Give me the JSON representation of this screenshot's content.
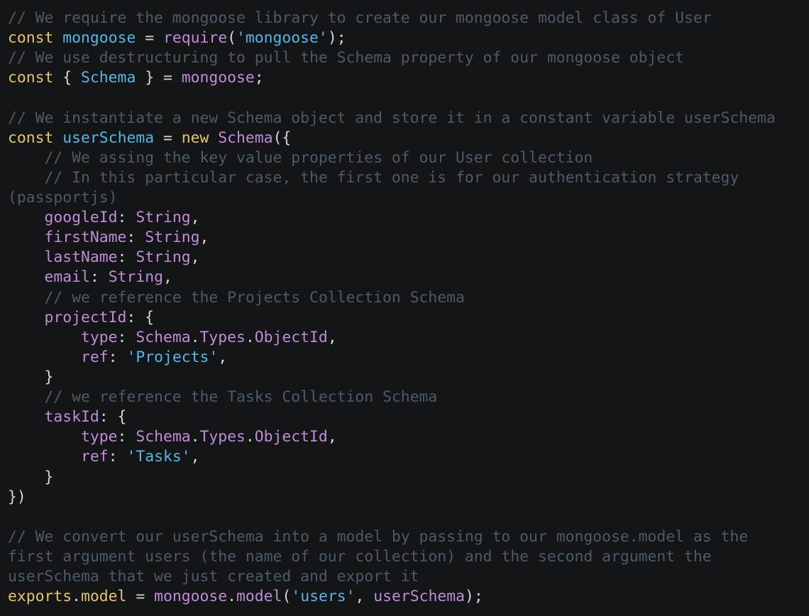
{
  "colors": {
    "background": "#141517",
    "keyword": "#e8c46a",
    "identifier": "#56b6e8",
    "function": "#c08bd8",
    "string": "#56b6e8",
    "comment": "#4e5a66",
    "punctuation": "#d6d6d6",
    "property": "#c08bd8"
  },
  "code_lines": [
    [
      {
        "t": "// We require the mongoose library to create our mongoose model class of User",
        "k": "comment"
      }
    ],
    [
      {
        "t": "const",
        "k": "keyword"
      },
      {
        "t": " ",
        "k": "punctuation"
      },
      {
        "t": "mongoose",
        "k": "identifier"
      },
      {
        "t": " = ",
        "k": "punctuation"
      },
      {
        "t": "require",
        "k": "function"
      },
      {
        "t": "(",
        "k": "punctuation"
      },
      {
        "t": "'mongoose'",
        "k": "string"
      },
      {
        "t": ");",
        "k": "punctuation"
      }
    ],
    [
      {
        "t": "// We use destructuring to pull the Schema property of our mongoose object",
        "k": "comment"
      }
    ],
    [
      {
        "t": "const",
        "k": "keyword"
      },
      {
        "t": " { ",
        "k": "punctuation"
      },
      {
        "t": "Schema",
        "k": "identifier"
      },
      {
        "t": " } = ",
        "k": "punctuation"
      },
      {
        "t": "mongoose",
        "k": "function"
      },
      {
        "t": ";",
        "k": "punctuation"
      }
    ],
    [],
    [
      {
        "t": "// We instantiate a new Schema object and store it in a constant variable userSchema",
        "k": "comment"
      }
    ],
    [
      {
        "t": "const",
        "k": "keyword"
      },
      {
        "t": " ",
        "k": "punctuation"
      },
      {
        "t": "userSchema",
        "k": "identifier"
      },
      {
        "t": " = ",
        "k": "punctuation"
      },
      {
        "t": "new",
        "k": "keyword"
      },
      {
        "t": " ",
        "k": "punctuation"
      },
      {
        "t": "Schema",
        "k": "function"
      },
      {
        "t": "({",
        "k": "punctuation"
      }
    ],
    [
      {
        "t": "    // We assing the key value properties of our User collection",
        "k": "comment"
      }
    ],
    [
      {
        "t": "    // In this particular case, the first one is for our authentication strategy",
        "k": "comment"
      }
    ],
    [
      {
        "t": "(passportjs)",
        "k": "comment"
      }
    ],
    [
      {
        "t": "    ",
        "k": "punctuation"
      },
      {
        "t": "googleId",
        "k": "property"
      },
      {
        "t": ": ",
        "k": "punctuation"
      },
      {
        "t": "String",
        "k": "function"
      },
      {
        "t": ",",
        "k": "punctuation"
      }
    ],
    [
      {
        "t": "    ",
        "k": "punctuation"
      },
      {
        "t": "firstName",
        "k": "property"
      },
      {
        "t": ": ",
        "k": "punctuation"
      },
      {
        "t": "String",
        "k": "function"
      },
      {
        "t": ",",
        "k": "punctuation"
      }
    ],
    [
      {
        "t": "    ",
        "k": "punctuation"
      },
      {
        "t": "lastName",
        "k": "property"
      },
      {
        "t": ": ",
        "k": "punctuation"
      },
      {
        "t": "String",
        "k": "function"
      },
      {
        "t": ",",
        "k": "punctuation"
      }
    ],
    [
      {
        "t": "    ",
        "k": "punctuation"
      },
      {
        "t": "email",
        "k": "property"
      },
      {
        "t": ": ",
        "k": "punctuation"
      },
      {
        "t": "String",
        "k": "function"
      },
      {
        "t": ",",
        "k": "punctuation"
      }
    ],
    [
      {
        "t": "    // we reference the Projects Collection Schema",
        "k": "comment"
      }
    ],
    [
      {
        "t": "    ",
        "k": "punctuation"
      },
      {
        "t": "projectId",
        "k": "property"
      },
      {
        "t": ": {",
        "k": "punctuation"
      }
    ],
    [
      {
        "t": "        ",
        "k": "punctuation"
      },
      {
        "t": "type",
        "k": "property"
      },
      {
        "t": ": ",
        "k": "punctuation"
      },
      {
        "t": "Schema",
        "k": "function"
      },
      {
        "t": ".",
        "k": "punctuation"
      },
      {
        "t": "Types",
        "k": "function"
      },
      {
        "t": ".",
        "k": "punctuation"
      },
      {
        "t": "ObjectId",
        "k": "function"
      },
      {
        "t": ",",
        "k": "punctuation"
      }
    ],
    [
      {
        "t": "        ",
        "k": "punctuation"
      },
      {
        "t": "ref",
        "k": "property"
      },
      {
        "t": ": ",
        "k": "punctuation"
      },
      {
        "t": "'Projects'",
        "k": "string"
      },
      {
        "t": ",",
        "k": "punctuation"
      }
    ],
    [
      {
        "t": "    }",
        "k": "punctuation"
      }
    ],
    [
      {
        "t": "    // we reference the Tasks Collection Schema",
        "k": "comment"
      }
    ],
    [
      {
        "t": "    ",
        "k": "punctuation"
      },
      {
        "t": "taskId",
        "k": "property"
      },
      {
        "t": ": {",
        "k": "punctuation"
      }
    ],
    [
      {
        "t": "        ",
        "k": "punctuation"
      },
      {
        "t": "type",
        "k": "property"
      },
      {
        "t": ": ",
        "k": "punctuation"
      },
      {
        "t": "Schema",
        "k": "function"
      },
      {
        "t": ".",
        "k": "punctuation"
      },
      {
        "t": "Types",
        "k": "function"
      },
      {
        "t": ".",
        "k": "punctuation"
      },
      {
        "t": "ObjectId",
        "k": "function"
      },
      {
        "t": ",",
        "k": "punctuation"
      }
    ],
    [
      {
        "t": "        ",
        "k": "punctuation"
      },
      {
        "t": "ref",
        "k": "property"
      },
      {
        "t": ": ",
        "k": "punctuation"
      },
      {
        "t": "'Tasks'",
        "k": "string"
      },
      {
        "t": ",",
        "k": "punctuation"
      }
    ],
    [
      {
        "t": "    }",
        "k": "punctuation"
      }
    ],
    [
      {
        "t": "})",
        "k": "punctuation"
      }
    ],
    [],
    [
      {
        "t": "// We convert our userSchema into a model by passing to our mongoose.model as the",
        "k": "comment"
      }
    ],
    [
      {
        "t": "first argument users (the name of our collection) and the second argument the",
        "k": "comment"
      }
    ],
    [
      {
        "t": "userSchema that we just created and export it",
        "k": "comment"
      }
    ],
    [
      {
        "t": "exports",
        "k": "keyword"
      },
      {
        "t": ".",
        "k": "punctuation"
      },
      {
        "t": "model",
        "k": "keyword"
      },
      {
        "t": " = ",
        "k": "punctuation"
      },
      {
        "t": "mongoose",
        "k": "function"
      },
      {
        "t": ".",
        "k": "punctuation"
      },
      {
        "t": "model",
        "k": "function"
      },
      {
        "t": "(",
        "k": "punctuation"
      },
      {
        "t": "'users'",
        "k": "string"
      },
      {
        "t": ", ",
        "k": "punctuation"
      },
      {
        "t": "userSchema",
        "k": "function"
      },
      {
        "t": ");",
        "k": "punctuation"
      }
    ]
  ]
}
